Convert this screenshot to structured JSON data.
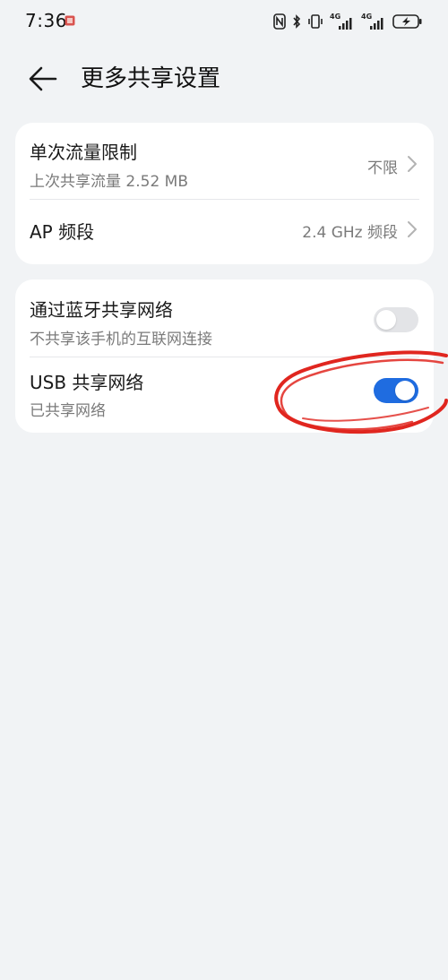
{
  "status_bar": {
    "time": "7:36",
    "network_1": "4G",
    "network_2": "4G"
  },
  "header": {
    "title": "更多共享设置"
  },
  "card_1": {
    "data_limit": {
      "title": "单次流量限制",
      "subtitle": "上次共享流量 2.52 MB",
      "value": "不限"
    },
    "ap_band": {
      "title": "AP 频段",
      "value": "2.4 GHz 频段"
    }
  },
  "card_2": {
    "bluetooth": {
      "title": "通过蓝牙共享网络",
      "subtitle": "不共享该手机的互联网连接",
      "enabled": false
    },
    "usb": {
      "title": "USB 共享网络",
      "subtitle": "已共享网络",
      "enabled": true
    }
  },
  "colors": {
    "background": "#f1f3f5",
    "card": "#ffffff",
    "accent": "#1f6ce0",
    "toggle_off": "#e3e4e7",
    "annotation": "#e0261f"
  }
}
